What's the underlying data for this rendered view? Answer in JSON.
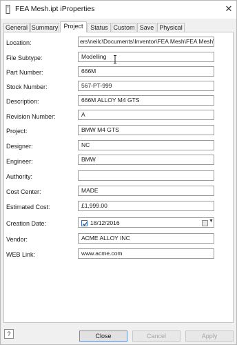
{
  "window": {
    "title": "FEA Mesh.ipt iProperties",
    "close_glyph": "✕",
    "app_icon": "document-icon"
  },
  "tabs": [
    {
      "label": "General",
      "active": false
    },
    {
      "label": "Summary",
      "active": false
    },
    {
      "label": "Project",
      "active": true
    },
    {
      "label": "Status",
      "active": false
    },
    {
      "label": "Custom",
      "active": false
    },
    {
      "label": "Save",
      "active": false
    },
    {
      "label": "Physical",
      "active": false
    }
  ],
  "fields": {
    "location": {
      "label": "Location:",
      "value": "ers\\neilc\\Documents\\Inventor\\FEA Mesh\\FEA Mesh\\"
    },
    "file_subtype": {
      "label": "File Subtype:",
      "value": "Modelling"
    },
    "part_number": {
      "label": "Part Number:",
      "value": "666M"
    },
    "stock_number": {
      "label": "Stock Number:",
      "value": "567-PT-999"
    },
    "description": {
      "label": "Description:",
      "value": "666M ALLOY M4 GTS"
    },
    "revision_number": {
      "label": "Revision Number:",
      "value": "A"
    },
    "project": {
      "label": "Project:",
      "value": "BMW M4 GTS"
    },
    "designer": {
      "label": "Designer:",
      "value": "NC"
    },
    "engineer": {
      "label": "Engineer:",
      "value": "BMW"
    },
    "authority": {
      "label": "Authority:",
      "value": ""
    },
    "cost_center": {
      "label": "Cost Center:",
      "value": "MADE"
    },
    "estimated_cost": {
      "label": "Estimated Cost:",
      "value": "£1,999.00"
    },
    "creation_date": {
      "label": "Creation Date:",
      "value": "18/12/2016",
      "checked": true
    },
    "vendor": {
      "label": "Vendor:",
      "value": "ACME ALLOY INC"
    },
    "web_link": {
      "label": "WEB Link:",
      "value": "www.acme.com"
    }
  },
  "footer": {
    "help_glyph": "?",
    "close_label": "Close",
    "cancel_label": "Cancel",
    "apply_label": "Apply"
  },
  "colors": {
    "accent_border": "#6c8ec4",
    "disabled_text": "#a6a6a6"
  }
}
